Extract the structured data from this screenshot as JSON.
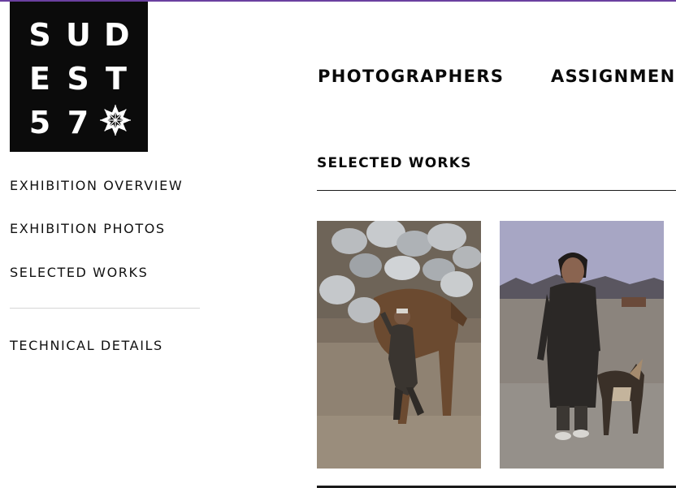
{
  "logo": {
    "glyphs": [
      "S",
      "U",
      "D",
      "E",
      "S",
      "T",
      "5",
      "7"
    ],
    "star_icon": "eight-point-star-icon"
  },
  "top_nav": {
    "items": [
      {
        "label": "PHOTOGRAPHERS"
      },
      {
        "label": "ASSIGNMEN"
      }
    ]
  },
  "side_nav": {
    "items": [
      {
        "label": "EXHIBITION OVERVIEW"
      },
      {
        "label": "EXHIBITION PHOTOS"
      },
      {
        "label": "SELECTED WORKS"
      },
      {
        "label": "TECHNICAL DETAILS"
      }
    ]
  },
  "main": {
    "section_title": "SELECTED WORKS",
    "photos": [
      {
        "subject": "boy beside camel loaded with aluminium pots"
      },
      {
        "subject": "young man standing with dog on dirt road"
      }
    ]
  },
  "colors": {
    "top_rule": "#6a3fa0",
    "logo_bg": "#0b0b0b",
    "text": "#111111"
  }
}
